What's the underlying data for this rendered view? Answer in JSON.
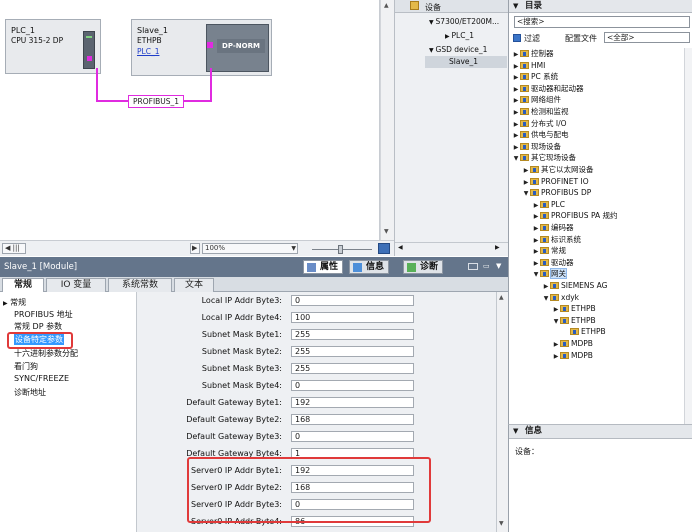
{
  "network": {
    "plc": {
      "name": "PLC_1",
      "type": "CPU 315-2 DP"
    },
    "slave": {
      "name": "Slave_1",
      "type": "ETHPB",
      "link": "PLC_1",
      "module_label": "DP-NORM"
    },
    "bus_label": "PROFIBUS_1",
    "zoom": "100%",
    "hscroll_symbol": "|||"
  },
  "device_tree": {
    "header": "设备",
    "items": [
      {
        "label": "S7300/ET200M..."
      },
      {
        "label": "PLC_1"
      },
      {
        "label": "GSD device_1"
      },
      {
        "label": "Slave_1"
      }
    ]
  },
  "catalog": {
    "title": "目录",
    "search_placeholder": "<搜索>",
    "filter_label": "过滤",
    "profile_label": "配置文件",
    "profile_value": "<全部>",
    "items": [
      {
        "label": "控制器",
        "level": 0,
        "exp": "▶"
      },
      {
        "label": "HMI",
        "level": 0,
        "exp": "▶"
      },
      {
        "label": "PC 系统",
        "level": 0,
        "exp": "▶"
      },
      {
        "label": "驱动器和起动器",
        "level": 0,
        "exp": "▶"
      },
      {
        "label": "网络组件",
        "level": 0,
        "exp": "▶"
      },
      {
        "label": "检测和监视",
        "level": 0,
        "exp": "▶"
      },
      {
        "label": "分布式 I/O",
        "level": 0,
        "exp": "▶"
      },
      {
        "label": "供电与配电",
        "level": 0,
        "exp": "▶"
      },
      {
        "label": "现场设备",
        "level": 0,
        "exp": "▶"
      },
      {
        "label": "其它现场设备",
        "level": 0,
        "exp": "▼"
      },
      {
        "label": "其它以太网设备",
        "level": 1,
        "exp": "▶"
      },
      {
        "label": "PROFINET IO",
        "level": 1,
        "exp": "▶"
      },
      {
        "label": "PROFIBUS DP",
        "level": 1,
        "exp": "▼"
      },
      {
        "label": "PLC",
        "level": 2,
        "exp": "▶"
      },
      {
        "label": "PROFIBUS PA 规约",
        "level": 2,
        "exp": "▶"
      },
      {
        "label": "编码器",
        "level": 2,
        "exp": "▶"
      },
      {
        "label": "标识系统",
        "level": 2,
        "exp": "▶"
      },
      {
        "label": "常规",
        "level": 2,
        "exp": "▶"
      },
      {
        "label": "驱动器",
        "level": 2,
        "exp": "▶"
      },
      {
        "label": "网关",
        "level": 2,
        "exp": "▼",
        "highlight": true
      },
      {
        "label": "SIEMENS AG",
        "level": 3,
        "exp": "▶"
      },
      {
        "label": "xdyk",
        "level": 3,
        "exp": "▼"
      },
      {
        "label": "ETHPB",
        "level": 4,
        "exp": "▶"
      },
      {
        "label": "ETHPB",
        "level": 4,
        "exp": "▼"
      },
      {
        "label": "ETHPB",
        "level": 5,
        "exp": ""
      },
      {
        "label": "MDPB",
        "level": 4,
        "exp": "▶"
      },
      {
        "label": "MDPB",
        "level": 4,
        "exp": "▶"
      }
    ]
  },
  "info_panel": {
    "title": "信息",
    "device_label": "设备："
  },
  "properties": {
    "title": "Slave_1 [Module]",
    "tabs": [
      "属性",
      "信息",
      "诊断"
    ],
    "inner_tabs": [
      "常规",
      "IO 变量",
      "系统常数",
      "文本"
    ],
    "nav_items": [
      {
        "label": "常规",
        "expander": "▶"
      },
      {
        "label": "PROFIBUS 地址"
      },
      {
        "label": "常规 DP 参数"
      },
      {
        "label": "设备特定参数",
        "selected": true
      },
      {
        "label": "十六进制参数分配"
      },
      {
        "label": "看门狗"
      },
      {
        "label": "SYNC/FREEZE"
      },
      {
        "label": "诊断地址"
      }
    ],
    "fields": [
      {
        "label": "Local IP Addr Byte3:",
        "value": "0"
      },
      {
        "label": "Local IP Addr Byte4:",
        "value": "100"
      },
      {
        "label": "Subnet Mask Byte1:",
        "value": "255"
      },
      {
        "label": "Subnet Mask Byte2:",
        "value": "255"
      },
      {
        "label": "Subnet Mask Byte3:",
        "value": "255"
      },
      {
        "label": "Subnet Mask Byte4:",
        "value": "0"
      },
      {
        "label": "Default Gateway Byte1:",
        "value": "192"
      },
      {
        "label": "Default Gateway Byte2:",
        "value": "168"
      },
      {
        "label": "Default Gateway Byte3:",
        "value": "0"
      },
      {
        "label": "Default Gateway Byte4:",
        "value": "1"
      },
      {
        "label": "Server0 IP Addr Byte1:",
        "value": "192"
      },
      {
        "label": "Server0 IP Addr Byte2:",
        "value": "168"
      },
      {
        "label": "Server0 IP Addr Byte3:",
        "value": "0"
      },
      {
        "label": "Server0 IP Addr Byte4:",
        "value": "86"
      }
    ]
  },
  "colors": {
    "accent_bus": "#e02be0",
    "header_bg": "#64758b",
    "highlight_box": "#e03a3a",
    "selection": "#3399ff"
  }
}
